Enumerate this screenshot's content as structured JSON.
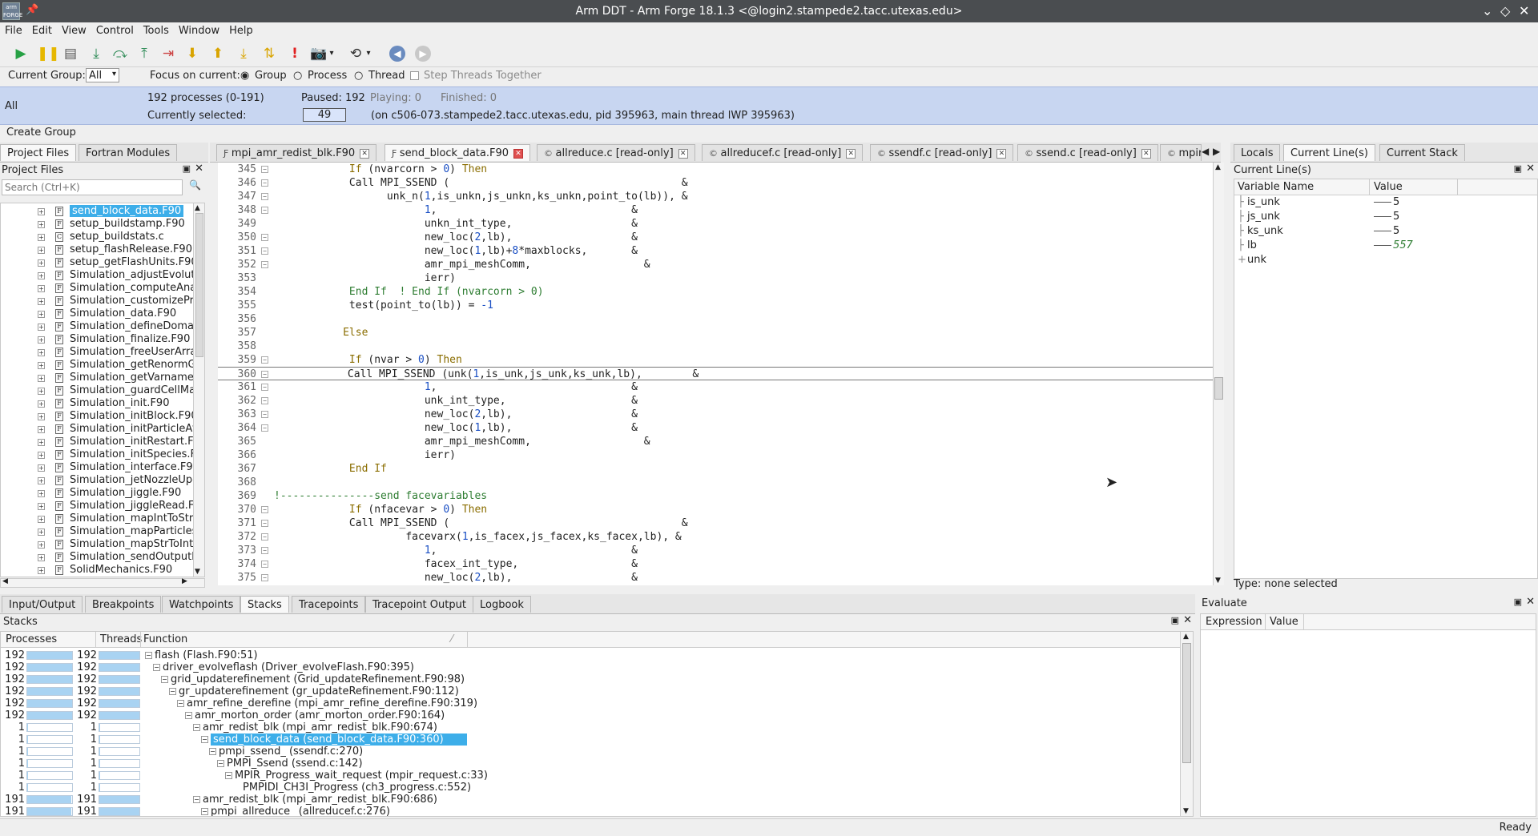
{
  "window": {
    "title": "Arm DDT - Arm Forge 18.1.3 <@login2.stampede2.tacc.utexas.edu>",
    "logo_text": "arm FORGE",
    "controls": [
      "⌄",
      "◇",
      "✕"
    ]
  },
  "menu": [
    "File",
    "Edit",
    "View",
    "Control",
    "Tools",
    "Window",
    "Help"
  ],
  "toolbar": {
    "icons": [
      "play-icon",
      "pause-icon",
      "add-breakpoint-icon",
      "step-into-icon",
      "step-over-icon",
      "step-out-icon",
      "run-to-line-icon",
      "down-frame-icon",
      "up-frame-icon",
      "bottom-frame-icon",
      "align-stacks-icon",
      "exclamation-icon",
      "camera-icon",
      "camera-dropdown-icon",
      "snapshot-icon",
      "snapshot-dropdown-icon",
      "back-icon",
      "forward-icon"
    ]
  },
  "groupbar": {
    "current_group_label": "Current Group:",
    "current_group_value": "All",
    "focus_label": "Focus on current:",
    "focus_group": "Group",
    "focus_process": "Process",
    "focus_thread": "Thread",
    "step_threads": "Step Threads Together"
  },
  "status": {
    "group": "All",
    "processes": "192 processes (0-191)",
    "paused": "Paused: 192",
    "playing": "Playing: 0",
    "finished": "Finished: 0",
    "currently_selected": "Currently selected:",
    "selected_value": "49",
    "selected_detail": "(on c506-073.stampede2.tacc.utexas.edu, pid 395963, main thread lWP 395963)"
  },
  "create_group": "Create Group",
  "left_tabs": [
    "Project Files",
    "Fortran Modules"
  ],
  "project_files": {
    "header": "Project Files",
    "search_placeholder": "Search (Ctrl+K)",
    "files": [
      {
        "name": "send_block_data.F90",
        "type": "F"
      },
      {
        "name": "setup_buildstamp.F90",
        "type": "F"
      },
      {
        "name": "setup_buildstats.c",
        "type": "C"
      },
      {
        "name": "setup_flashRelease.F90",
        "type": "F"
      },
      {
        "name": "setup_getFlashUnits.F90",
        "type": "F"
      },
      {
        "name": "Simulation_adjustEvolutio",
        "type": "F"
      },
      {
        "name": "Simulation_computeAnal",
        "type": "F"
      },
      {
        "name": "Simulation_customizePro",
        "type": "F"
      },
      {
        "name": "Simulation_data.F90",
        "type": "F"
      },
      {
        "name": "Simulation_defineDomain",
        "type": "F"
      },
      {
        "name": "Simulation_finalize.F90",
        "type": "F"
      },
      {
        "name": "Simulation_freeUserArray",
        "type": "F"
      },
      {
        "name": "Simulation_getRenormGr",
        "type": "F"
      },
      {
        "name": "Simulation_getVarnameTy",
        "type": "F"
      },
      {
        "name": "Simulation_guardCellMas",
        "type": "F"
      },
      {
        "name": "Simulation_init.F90",
        "type": "F"
      },
      {
        "name": "Simulation_initBlock.F90",
        "type": "F"
      },
      {
        "name": "Simulation_initParticleAtt",
        "type": "F"
      },
      {
        "name": "Simulation_initRestart.F9",
        "type": "F"
      },
      {
        "name": "Simulation_initSpecies.F9",
        "type": "F"
      },
      {
        "name": "Simulation_interface.F90",
        "type": "F"
      },
      {
        "name": "Simulation_jetNozzleUpda",
        "type": "F"
      },
      {
        "name": "Simulation_jiggle.F90",
        "type": "F"
      },
      {
        "name": "Simulation_jiggleRead.F9",
        "type": "F"
      },
      {
        "name": "Simulation_mapIntToStr.F",
        "type": "F"
      },
      {
        "name": "Simulation_mapParticles\\",
        "type": "F"
      },
      {
        "name": "Simulation_mapStrToInt.F",
        "type": "F"
      },
      {
        "name": "Simulation_sendOutputD",
        "type": "F"
      },
      {
        "name": "SolidMechanics.F90",
        "type": "F"
      }
    ]
  },
  "editor_tabs": [
    "mpi_amr_redist_blk.F90",
    "send_block_data.F90",
    "allreduce.c [read-only]",
    "allreducef.c [read-only]",
    "ssendf.c [read-only]",
    "ssend.c [read-only]",
    "mpir"
  ],
  "code": [
    {
      "n": "345",
      "t": "            If (nvarcorn > 0) Then",
      "f": true
    },
    {
      "n": "346",
      "t": "            Call MPI_SSEND (                                     &",
      "f": true
    },
    {
      "n": "347",
      "t": "                  unk_n(1,is_unkn,js_unkn,ks_unkn,point_to(lb)), &",
      "f": true
    },
    {
      "n": "348",
      "t": "                        1,                               &",
      "f": true
    },
    {
      "n": "349",
      "t": "                        unkn_int_type,                   &",
      "f": false
    },
    {
      "n": "350",
      "t": "                        new_loc(2,lb),                   &",
      "f": true
    },
    {
      "n": "351",
      "t": "                        new_loc(1,lb)+8*maxblocks,       &",
      "f": true
    },
    {
      "n": "352",
      "t": "                        amr_mpi_meshComm,                  &",
      "f": true
    },
    {
      "n": "353",
      "t": "                        ierr)",
      "f": false
    },
    {
      "n": "354",
      "t": "            End If  ! End If (nvarcorn > 0)",
      "f": false,
      "c": true
    },
    {
      "n": "355",
      "t": "            test(point_to(lb)) = -1",
      "f": false
    },
    {
      "n": "356",
      "t": "",
      "f": false
    },
    {
      "n": "357",
      "t": "           Else",
      "f": false
    },
    {
      "n": "358",
      "t": "",
      "f": false
    },
    {
      "n": "359",
      "t": "            If (nvar > 0) Then",
      "f": true
    },
    {
      "n": "360",
      "t": "            Call MPI_SSEND (unk(1,is_unk,js_unk,ks_unk,lb),        &",
      "f": true,
      "cur": true
    },
    {
      "n": "361",
      "t": "                        1,                               &",
      "f": true
    },
    {
      "n": "362",
      "t": "                        unk_int_type,                    &",
      "f": true
    },
    {
      "n": "363",
      "t": "                        new_loc(2,lb),                   &",
      "f": true
    },
    {
      "n": "364",
      "t": "                        new_loc(1,lb),                   &",
      "f": true
    },
    {
      "n": "365",
      "t": "                        amr_mpi_meshComm,                  &",
      "f": false
    },
    {
      "n": "366",
      "t": "                        ierr)",
      "f": false
    },
    {
      "n": "367",
      "t": "            End If",
      "f": false
    },
    {
      "n": "368",
      "t": "",
      "f": false
    },
    {
      "n": "369",
      "t": "!---------------send facevariables",
      "f": false,
      "c": true
    },
    {
      "n": "370",
      "t": "            If (nfacevar > 0) Then",
      "f": true
    },
    {
      "n": "371",
      "t": "            Call MPI_SSEND (                                     &",
      "f": true
    },
    {
      "n": "372",
      "t": "                     facevarx(1,is_facex,js_facex,ks_facex,lb), &",
      "f": true
    },
    {
      "n": "373",
      "t": "                        1,                               &",
      "f": true
    },
    {
      "n": "374",
      "t": "                        facex_int_type,                  &",
      "f": true
    },
    {
      "n": "375",
      "t": "                        new_loc(2,lb),                   &",
      "f": true
    }
  ],
  "right_tabs": [
    "Locals",
    "Current Line(s)",
    "Current Stack"
  ],
  "current_lines": {
    "header": "Current Line(s)",
    "col_name": "Variable Name",
    "col_value": "Value",
    "vars": [
      {
        "name": "is_unk",
        "value": "5"
      },
      {
        "name": "js_unk",
        "value": "5"
      },
      {
        "name": "ks_unk",
        "value": "5"
      },
      {
        "name": "lb",
        "value": "557"
      },
      {
        "name": "unk",
        "value": ""
      }
    ],
    "type_text": "Type: none selected"
  },
  "bottom_tabs": [
    "Input/Output",
    "Breakpoints",
    "Watchpoints",
    "Stacks",
    "Tracepoints",
    "Tracepoint Output",
    "Logbook"
  ],
  "stacks": {
    "header": "Stacks",
    "col_processes": "Processes",
    "col_threads": "Threads",
    "col_function": "Function",
    "rows": [
      {
        "p": "192",
        "pf": 1,
        "t": "192",
        "tf": 1,
        "d": 0,
        "fn": "flash (Flash.F90:51)",
        "exp": "−"
      },
      {
        "p": "192",
        "pf": 1,
        "t": "192",
        "tf": 1,
        "d": 1,
        "fn": "driver_evolveflash (Driver_evolveFlash.F90:395)",
        "exp": "−"
      },
      {
        "p": "192",
        "pf": 1,
        "t": "192",
        "tf": 1,
        "d": 2,
        "fn": "grid_updaterefinement (Grid_updateRefinement.F90:98)",
        "exp": "−"
      },
      {
        "p": "192",
        "pf": 1,
        "t": "192",
        "tf": 1,
        "d": 3,
        "fn": "gr_updaterefinement (gr_updateRefinement.F90:112)",
        "exp": "−"
      },
      {
        "p": "192",
        "pf": 1,
        "t": "192",
        "tf": 1,
        "d": 4,
        "fn": "amr_refine_derefine (mpi_amr_refine_derefine.F90:319)",
        "exp": "−"
      },
      {
        "p": "192",
        "pf": 1,
        "t": "192",
        "tf": 1,
        "d": 5,
        "fn": "amr_morton_order (amr_morton_order.F90:164)",
        "exp": "−"
      },
      {
        "p": "1",
        "pf": 0.01,
        "t": "1",
        "tf": 0.01,
        "d": 6,
        "fn": "amr_redist_blk (mpi_amr_redist_blk.F90:674)",
        "exp": "−"
      },
      {
        "p": "1",
        "pf": 0.01,
        "t": "1",
        "tf": 0.01,
        "d": 7,
        "fn": "send_block_data (send_block_data.F90:360)",
        "exp": "−",
        "sel": true
      },
      {
        "p": "1",
        "pf": 0.01,
        "t": "1",
        "tf": 0.01,
        "d": 8,
        "fn": "pmpi_ssend_ (ssendf.c:270)",
        "exp": "−"
      },
      {
        "p": "1",
        "pf": 0.01,
        "t": "1",
        "tf": 0.01,
        "d": 9,
        "fn": "PMPI_Ssend (ssend.c:142)",
        "exp": "−"
      },
      {
        "p": "1",
        "pf": 0.01,
        "t": "1",
        "tf": 0.01,
        "d": 10,
        "fn": "MPIR_Progress_wait_request (mpir_request.c:33)",
        "exp": "−"
      },
      {
        "p": "1",
        "pf": 0.01,
        "t": "1",
        "tf": 0.01,
        "d": 11,
        "fn": "PMPIDI_CH3I_Progress (ch3_progress.c:552)",
        "exp": ""
      },
      {
        "p": "191",
        "pf": 0.99,
        "t": "191",
        "tf": 0.99,
        "d": 6,
        "fn": "amr_redist_blk (mpi_amr_redist_blk.F90:686)",
        "exp": "−"
      },
      {
        "p": "191",
        "pf": 0.99,
        "t": "191",
        "tf": 0.99,
        "d": 7,
        "fn": "pmpi_allreduce_ (allreducef.c:276)",
        "exp": "−"
      }
    ]
  },
  "evaluate": {
    "header": "Evaluate",
    "col_expression": "Expression",
    "col_value": "Value"
  },
  "statusbar": "Ready"
}
